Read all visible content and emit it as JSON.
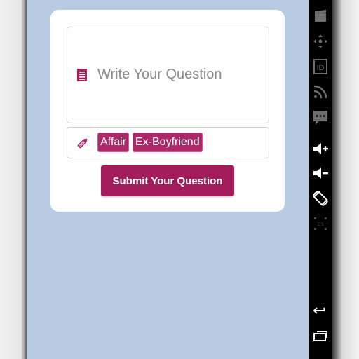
{
  "question": {
    "placeholder": "Write Your Question",
    "icon": "document-icon"
  },
  "tags": {
    "icon": "pencil-icon",
    "items": [
      "Affair",
      "Ex-Boyfriend"
    ]
  },
  "submit_label": "Submit Your Question",
  "colors": {
    "background": "#b7cce3",
    "card": "#ffffff",
    "accent": "#a31d5c",
    "tag": "#ad2868",
    "placeholder": "#8a8a8a",
    "nav_bar": "#000000"
  },
  "emulator_toolbar": {
    "icons": [
      "clapperboard-icon",
      "dpad-icon",
      "id-icon",
      "rss-icon",
      "message-icon",
      "volume-up-icon",
      "volume-down-icon",
      "rotate-icon",
      "scale-icon",
      "back-icon",
      "recent-apps-icon"
    ]
  }
}
